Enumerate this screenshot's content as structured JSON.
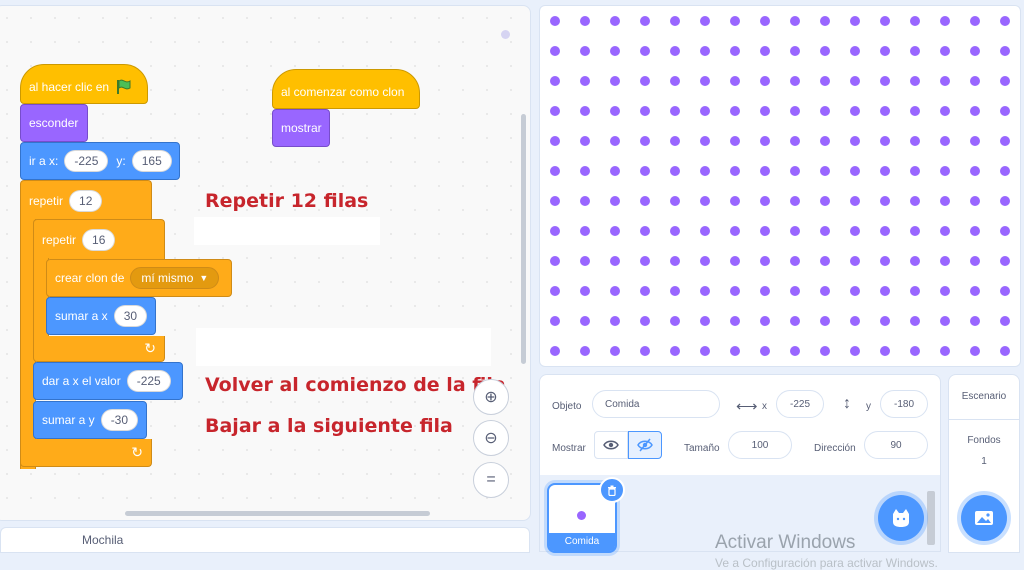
{
  "code": {
    "event_green_flag": "al hacer clic en",
    "hide": "esconder",
    "goto": {
      "label": "ir a x:",
      "x": "-225",
      "y_label": "y:",
      "y": "165"
    },
    "repeat_outer": {
      "label": "repetir",
      "count": "12"
    },
    "repeat_inner": {
      "label": "repetir",
      "count": "16"
    },
    "create_clone": {
      "label": "crear clon de",
      "option": "mí mismo"
    },
    "change_x": {
      "label": "sumar a x",
      "value": "30"
    },
    "set_x": {
      "label": "dar a x el valor",
      "value": "-225"
    },
    "change_y": {
      "label": "sumar a y",
      "value": "-30"
    },
    "when_clone": "al comenzar como clon",
    "show": "mostrar"
  },
  "annotations": {
    "a1": "Repetir 12 filas",
    "a2": "Volver al comienzo de la fila",
    "a3": "Bajar a la siguiente fila"
  },
  "zoom": {
    "reset": "="
  },
  "backpack": "Mochila",
  "stage": {
    "rows": 12,
    "cols": 16,
    "dot_color": "#9966ff"
  },
  "sprite_info": {
    "object_label": "Objeto",
    "object_name": "Comida",
    "x_label": "x",
    "x": "-225",
    "y_label": "y",
    "y": "-180",
    "show_label": "Mostrar",
    "size_label": "Tamaño",
    "size": "100",
    "direction_label": "Dirección",
    "direction": "90"
  },
  "sprite_list": [
    {
      "name": "Comida",
      "selected": true
    }
  ],
  "stage_panel": {
    "title": "Escenario",
    "backdrops_label": "Fondos",
    "backdrops_count": "1"
  },
  "watermark": {
    "line1": "Activar Windows",
    "line2": "Ve a Configuración para activar Windows."
  },
  "colors": {
    "events": "#ffbf00",
    "looks": "#9966ff",
    "motion": "#4c97ff",
    "control": "#ffab19",
    "annotation": "#c7252c"
  }
}
